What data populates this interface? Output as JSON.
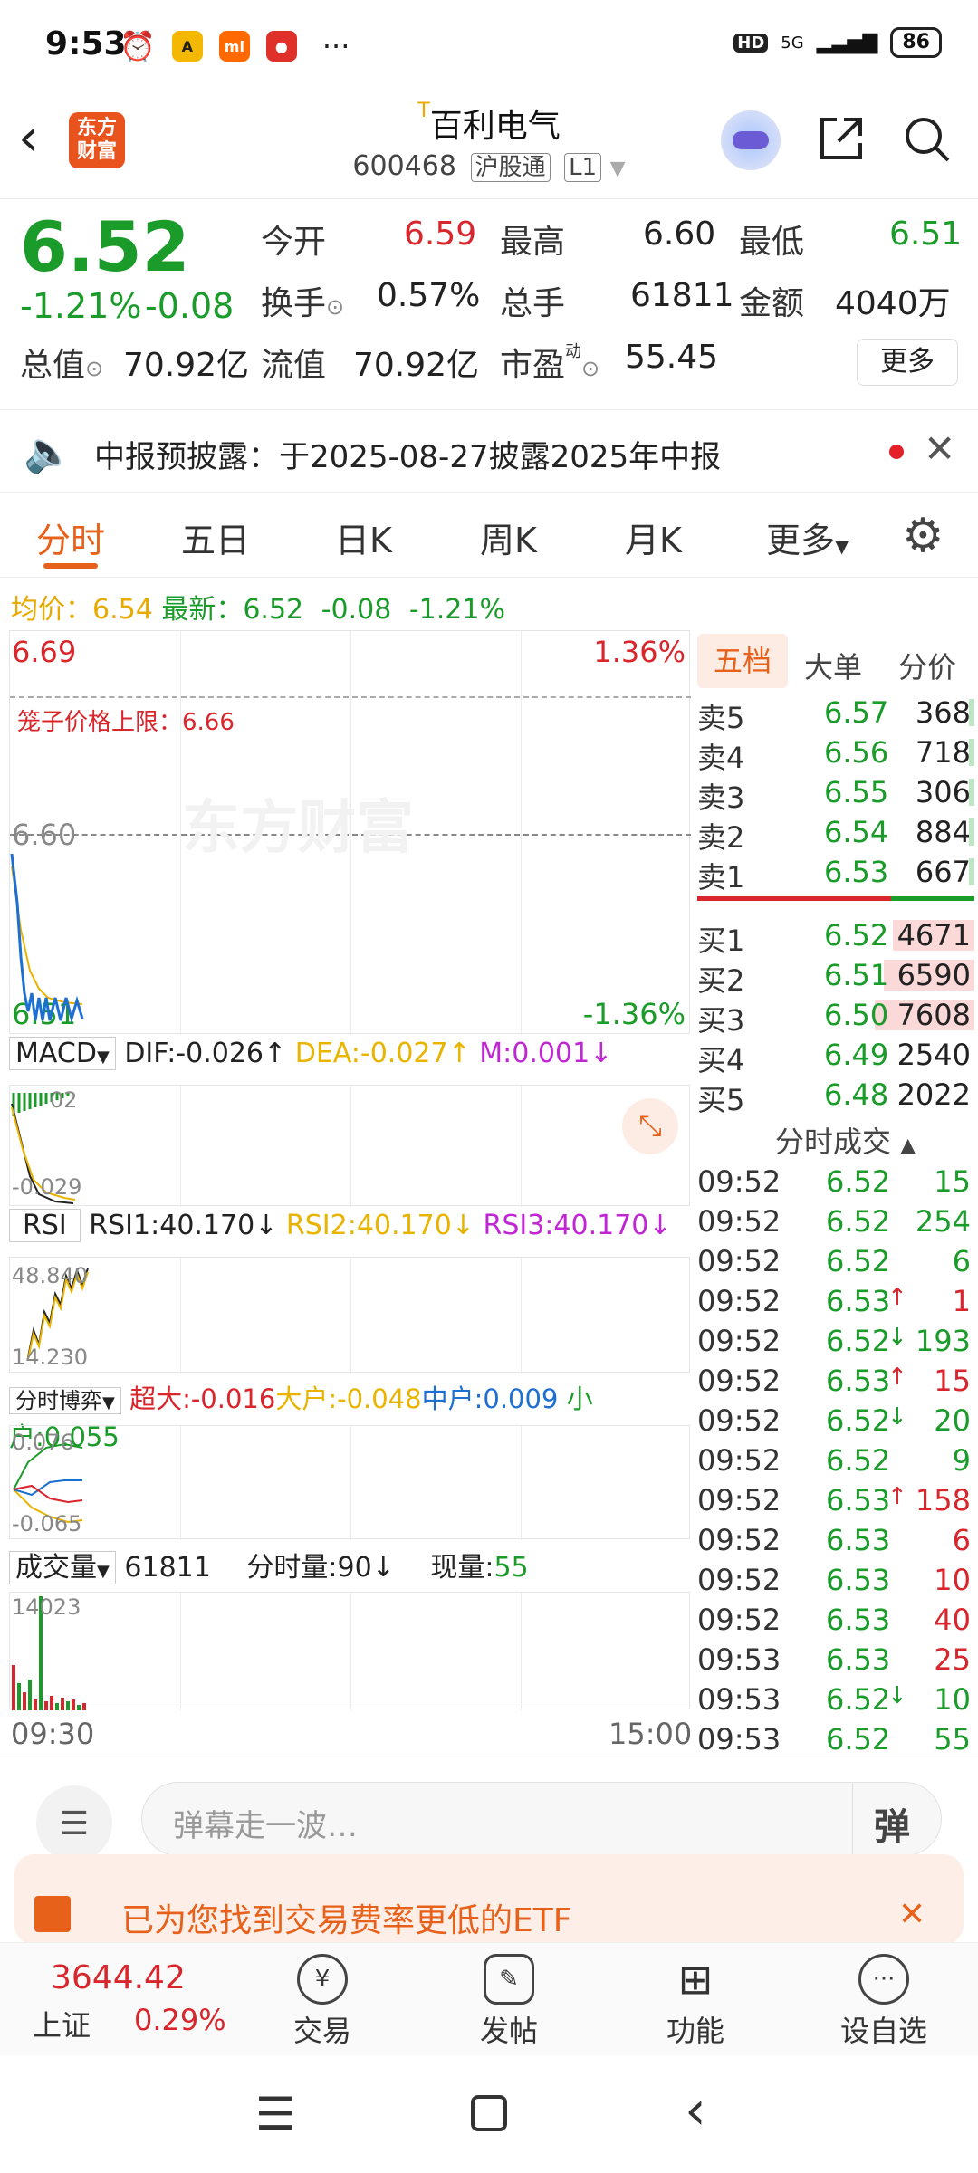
{
  "status": {
    "time": "9:53",
    "battery": "86",
    "network": "5G"
  },
  "header": {
    "logo_line1": "东方",
    "logo_line2": "财富",
    "stock_name": "百利电气",
    "code": "600468",
    "tag1": "沪股通",
    "tag2": "L1"
  },
  "quote": {
    "price": "6.52",
    "change_pct": "-1.21%",
    "change": "-0.08",
    "open_label": "今开",
    "open": "6.59",
    "high_label": "最高",
    "high": "6.60",
    "low_label": "最低",
    "low": "6.51",
    "turnover_label": "换手",
    "turnover": "0.57%",
    "volume_label": "总手",
    "volume": "61811",
    "amount_label": "金额",
    "amount": "4040万",
    "mcap_label": "总值",
    "mcap": "70.92亿",
    "float_label": "流值",
    "float": "70.92亿",
    "pe_label": "市盈",
    "pe": "55.45",
    "more_label": "更多"
  },
  "notice": {
    "text": "中报预披露：于2025-08-27披露2025年中报"
  },
  "tabs": [
    "分时",
    "五日",
    "日K",
    "周K",
    "月K",
    "更多"
  ],
  "summary": {
    "avg_label": "均价：",
    "avg": "6.54",
    "latest_label": "最新：",
    "latest": "6.52",
    "change": "-0.08",
    "pct": "-1.21%"
  },
  "chart": {
    "top_price": "6.69",
    "top_pct": "1.36%",
    "cage_label": "笼子价格上限：6.66",
    "mid_price": "6.60",
    "bottom_price": "6.51",
    "bottom_pct": "-1.36%",
    "watermark": "东方财富",
    "time_start": "09:30",
    "time_end": "15:00"
  },
  "macd": {
    "name": "MACD",
    "dif": "DIF:-0.026",
    "dea": "DEA:-0.027",
    "m": "M:0.001",
    "top": "02",
    "bottom": "-0.029"
  },
  "rsi": {
    "name": "RSI",
    "rsi1": "RSI1:40.170",
    "rsi2": "RSI2:40.170",
    "rsi3": "RSI3:40.170",
    "top": "48.840",
    "bottom": "14.230"
  },
  "flow": {
    "name": "分时博弈",
    "super": "超大:-0.016",
    "big": "大户:-0.048",
    "mid": "中户:0.009",
    "small": "小户:0.055",
    "top": "0.076",
    "bottom": "-0.065"
  },
  "vol": {
    "name": "成交量",
    "total": "61811",
    "min_vol": "分时量:90",
    "now_label": "现量:",
    "now": "55",
    "top": "14023"
  },
  "orderbook": {
    "tabs": [
      "五档",
      "大单",
      "分价"
    ],
    "asks": [
      {
        "label": "卖5",
        "price": "6.57",
        "qty": "368"
      },
      {
        "label": "卖4",
        "price": "6.56",
        "qty": "718"
      },
      {
        "label": "卖3",
        "price": "6.55",
        "qty": "306"
      },
      {
        "label": "卖2",
        "price": "6.54",
        "qty": "884"
      },
      {
        "label": "卖1",
        "price": "6.53",
        "qty": "667"
      }
    ],
    "bids": [
      {
        "label": "买1",
        "price": "6.52",
        "qty": "4671"
      },
      {
        "label": "买2",
        "price": "6.51",
        "qty": "6590"
      },
      {
        "label": "买3",
        "price": "6.50",
        "qty": "7608"
      },
      {
        "label": "买4",
        "price": "6.49",
        "qty": "2540"
      },
      {
        "label": "买5",
        "price": "6.48",
        "qty": "2022"
      }
    ],
    "trades_title": "分时成交",
    "trades": [
      {
        "t": "09:52",
        "p": "6.52",
        "q": "15",
        "dir": "",
        "pc": "green",
        "qc": "green"
      },
      {
        "t": "09:52",
        "p": "6.52",
        "q": "254",
        "dir": "",
        "pc": "green",
        "qc": "green"
      },
      {
        "t": "09:52",
        "p": "6.52",
        "q": "6",
        "dir": "",
        "pc": "green",
        "qc": "green"
      },
      {
        "t": "09:52",
        "p": "6.53",
        "q": "1",
        "dir": "↑",
        "pc": "green",
        "qc": "red"
      },
      {
        "t": "09:52",
        "p": "6.52",
        "q": "193",
        "dir": "↓",
        "pc": "green",
        "qc": "green"
      },
      {
        "t": "09:52",
        "p": "6.53",
        "q": "15",
        "dir": "↑",
        "pc": "green",
        "qc": "red"
      },
      {
        "t": "09:52",
        "p": "6.52",
        "q": "20",
        "dir": "↓",
        "pc": "green",
        "qc": "green"
      },
      {
        "t": "09:52",
        "p": "6.52",
        "q": "9",
        "dir": "",
        "pc": "green",
        "qc": "green"
      },
      {
        "t": "09:52",
        "p": "6.53",
        "q": "158",
        "dir": "↑",
        "pc": "green",
        "qc": "red"
      },
      {
        "t": "09:52",
        "p": "6.53",
        "q": "6",
        "dir": "",
        "pc": "green",
        "qc": "red"
      },
      {
        "t": "09:52",
        "p": "6.53",
        "q": "10",
        "dir": "",
        "pc": "green",
        "qc": "red"
      },
      {
        "t": "09:52",
        "p": "6.53",
        "q": "40",
        "dir": "",
        "pc": "green",
        "qc": "red"
      },
      {
        "t": "09:53",
        "p": "6.53",
        "q": "25",
        "dir": "",
        "pc": "green",
        "qc": "red"
      },
      {
        "t": "09:53",
        "p": "6.52",
        "q": "10",
        "dir": "↓",
        "pc": "green",
        "qc": "green"
      },
      {
        "t": "09:53",
        "p": "6.52",
        "q": "55",
        "dir": "",
        "pc": "green",
        "qc": "green"
      }
    ]
  },
  "comment": {
    "placeholder": "弹幕走一波…",
    "danmu": "弹"
  },
  "banner": {
    "text": "已为您找到交易费率更低的ETF"
  },
  "bottomnav": {
    "index_value": "3644.42",
    "index_name": "上证",
    "index_pct": "0.29%",
    "trade": "交易",
    "post": "发帖",
    "func": "功能",
    "watch": "设自选"
  }
}
